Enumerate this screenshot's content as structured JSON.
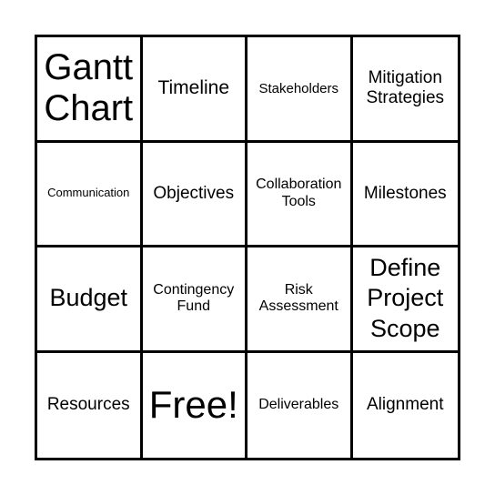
{
  "board": {
    "cells": [
      {
        "label": "Gantt Chart"
      },
      {
        "label": "Timeline"
      },
      {
        "label": "Stakeholders"
      },
      {
        "label": "Mitigation Strategies"
      },
      {
        "label": "Communication"
      },
      {
        "label": "Objectives"
      },
      {
        "label": "Collaboration Tools"
      },
      {
        "label": "Milestones"
      },
      {
        "label": "Budget"
      },
      {
        "label": "Contingency Fund"
      },
      {
        "label": "Risk Assessment"
      },
      {
        "label": "Define Project Scope"
      },
      {
        "label": "Resources"
      },
      {
        "label": "Free!"
      },
      {
        "label": "Deliverables"
      },
      {
        "label": "Alignment"
      }
    ]
  }
}
